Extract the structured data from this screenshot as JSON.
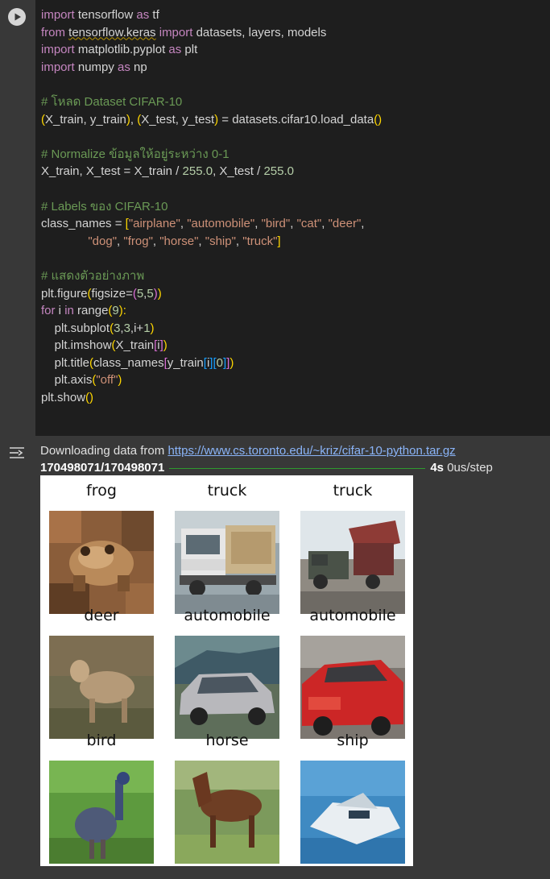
{
  "code": {
    "l1": {
      "a": "import",
      "b": " tensorflow ",
      "c": "as",
      "d": " tf"
    },
    "l2": {
      "a": "from",
      "b": " ",
      "c": "tensorflow.keras",
      "d": " ",
      "e": "import",
      "f": " datasets, layers, models"
    },
    "l3": {
      "a": "import",
      "b": " matplotlib.pyplot ",
      "c": "as",
      "d": " plt"
    },
    "l4": {
      "a": "import",
      "b": " numpy ",
      "c": "as",
      "d": " np"
    },
    "l6": "# โหลด Dataset CIFAR-10",
    "l7": {
      "a": "(",
      "b": "X_train, y_train",
      "c": ")",
      "d": ", ",
      "e": "(",
      "f": "X_test, y_test",
      "g": ")",
      "h": " = datasets.cifar10.load_data",
      "i": "()"
    },
    "l9": "# Normalize ข้อมูลให้อยู่ระหว่าง 0-1",
    "l10": {
      "a": "X_train, X_test = X_train / ",
      "b": "255.0",
      "c": ", X_test / ",
      "d": "255.0"
    },
    "l12": "# Labels ของ CIFAR-10",
    "l13": {
      "a": "class_names = ",
      "b": "[",
      "c": "\"airplane\"",
      "d": ", ",
      "e": "\"automobile\"",
      "f": ", ",
      "g": "\"bird\"",
      "h": ", ",
      "i": "\"cat\"",
      "j": ", ",
      "k": "\"deer\"",
      "l": ","
    },
    "l14": {
      "a": "              ",
      "b": "\"dog\"",
      "c": ", ",
      "d": "\"frog\"",
      "e": ", ",
      "f": "\"horse\"",
      "g": ", ",
      "h": "\"ship\"",
      "i": ", ",
      "j": "\"truck\"",
      "k": "]"
    },
    "l16": "# แสดงตัวอย่างภาพ",
    "l17": {
      "a": "plt.figure",
      "b": "(",
      "c": "figsize=",
      "d": "(",
      "e": "5",
      "f": ",",
      "g": "5",
      "h": ")",
      "i": ")"
    },
    "l18": {
      "a": "for",
      "b": " i ",
      "c": "in",
      "d": " range",
      "e": "(",
      "f": "9",
      "g": "):"
    },
    "l19": {
      "a": "    plt.subplot",
      "b": "(",
      "c": "3",
      "d": ",",
      "e": "3",
      "f": ",i+",
      "g": "1",
      "h": ")"
    },
    "l20": {
      "a": "    plt.imshow",
      "b": "(",
      "c": "X_train",
      "d": "[",
      "e": "i",
      "f": "]",
      "g": ")"
    },
    "l21": {
      "a": "    plt.title",
      "b": "(",
      "c": "class_names",
      "d": "[",
      "e": "y_train",
      "f": "[",
      "g": "i",
      "h": "]",
      "i": "[",
      "j": "0",
      "k": "]",
      "l": "]",
      "m": ")"
    },
    "l22": {
      "a": "    plt.axis",
      "b": "(",
      "c": "\"off\"",
      "d": ")"
    },
    "l23": {
      "a": "plt.show",
      "b": "()"
    }
  },
  "output": {
    "download_prefix": "Downloading data from ",
    "download_url": "https://www.cs.toronto.edu/~kriz/cifar-10-python.tar.gz",
    "progress_count": "170498071/170498071",
    "progress_time": "4s",
    "progress_rate": " 0us/step",
    "progress_fraction": 1.0
  },
  "figure": {
    "titles": [
      "frog",
      "truck",
      "truck",
      "deer",
      "automobile",
      "automobile",
      "bird",
      "horse",
      "ship"
    ]
  },
  "colors": {
    "editor_bg": "#1e1e1e",
    "cell_bg": "#383838",
    "keyword": "#c586c0",
    "comment": "#6a9955",
    "string": "#ce9178",
    "number": "#b5cea8",
    "link": "#8ab4f8",
    "progress": "#2e9a2e"
  },
  "icons": {
    "run": "play-circle-icon",
    "output": "output-collapse-icon"
  }
}
